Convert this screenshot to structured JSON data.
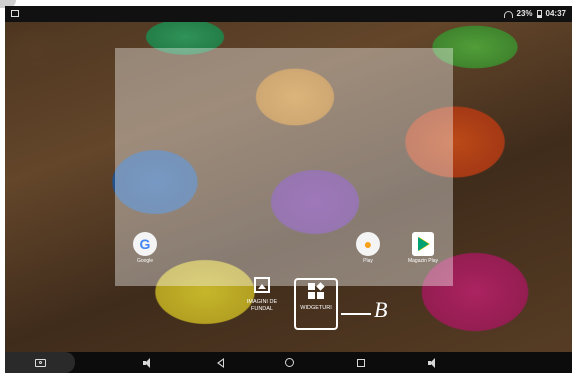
{
  "status_bar": {
    "battery": "23%",
    "time": "04:37"
  },
  "home_preview": {
    "apps": [
      {
        "label": "Google",
        "icon": "google-icon",
        "glyph": "G"
      },
      {
        "label": "Play",
        "icon": "play-games-icon",
        "glyph": "●"
      },
      {
        "label": "Magazin Play",
        "icon": "play-store-icon"
      }
    ]
  },
  "overview": {
    "wallpapers_label": "IMAGINI DE FUNDAL",
    "widgets_label": "WIDGETURI",
    "annotation": "B"
  },
  "nav_bar": {
    "buttons": [
      "screenshot-icon",
      "volume-down-icon",
      "back-icon",
      "home-icon",
      "recents-icon",
      "volume-up-icon"
    ]
  }
}
